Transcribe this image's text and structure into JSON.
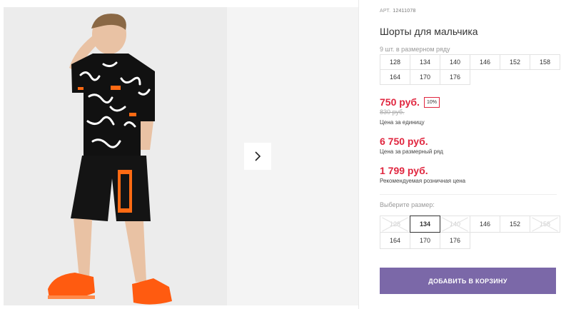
{
  "product": {
    "article_label": "АРТ.",
    "article_number": "12411078",
    "title": "Шорты для мальчика",
    "series_info": "9 шт. в размерном ряду",
    "series_sizes": [
      "128",
      "134",
      "140",
      "146",
      "152",
      "158",
      "164",
      "170",
      "176"
    ]
  },
  "pricing": {
    "price": "750 руб.",
    "discount": "10%",
    "old_price": "830 руб.",
    "unit_label": "Цена за единицу",
    "series_price": "6 750 руб.",
    "series_price_label": "Цена за размерный ряд",
    "rrp": "1 799 руб.",
    "rrp_label": "Рекомендуемая розничная цена"
  },
  "size_selector": {
    "label": "Выберите размер:",
    "options": [
      {
        "label": "128",
        "state": "disabled"
      },
      {
        "label": "134",
        "state": "selected"
      },
      {
        "label": "140",
        "state": "disabled"
      },
      {
        "label": "146",
        "state": "available"
      },
      {
        "label": "152",
        "state": "available"
      },
      {
        "label": "158",
        "state": "disabled"
      },
      {
        "label": "164",
        "state": "available"
      },
      {
        "label": "170",
        "state": "available"
      },
      {
        "label": "176",
        "state": "available"
      }
    ]
  },
  "actions": {
    "add_to_cart": "ДОБАВИТЬ В КОРЗИНУ"
  },
  "gallery": {
    "next_icon": "chevron-right-icon"
  },
  "colors": {
    "accent_price": "#e0263f",
    "button": "#7b68a8"
  }
}
